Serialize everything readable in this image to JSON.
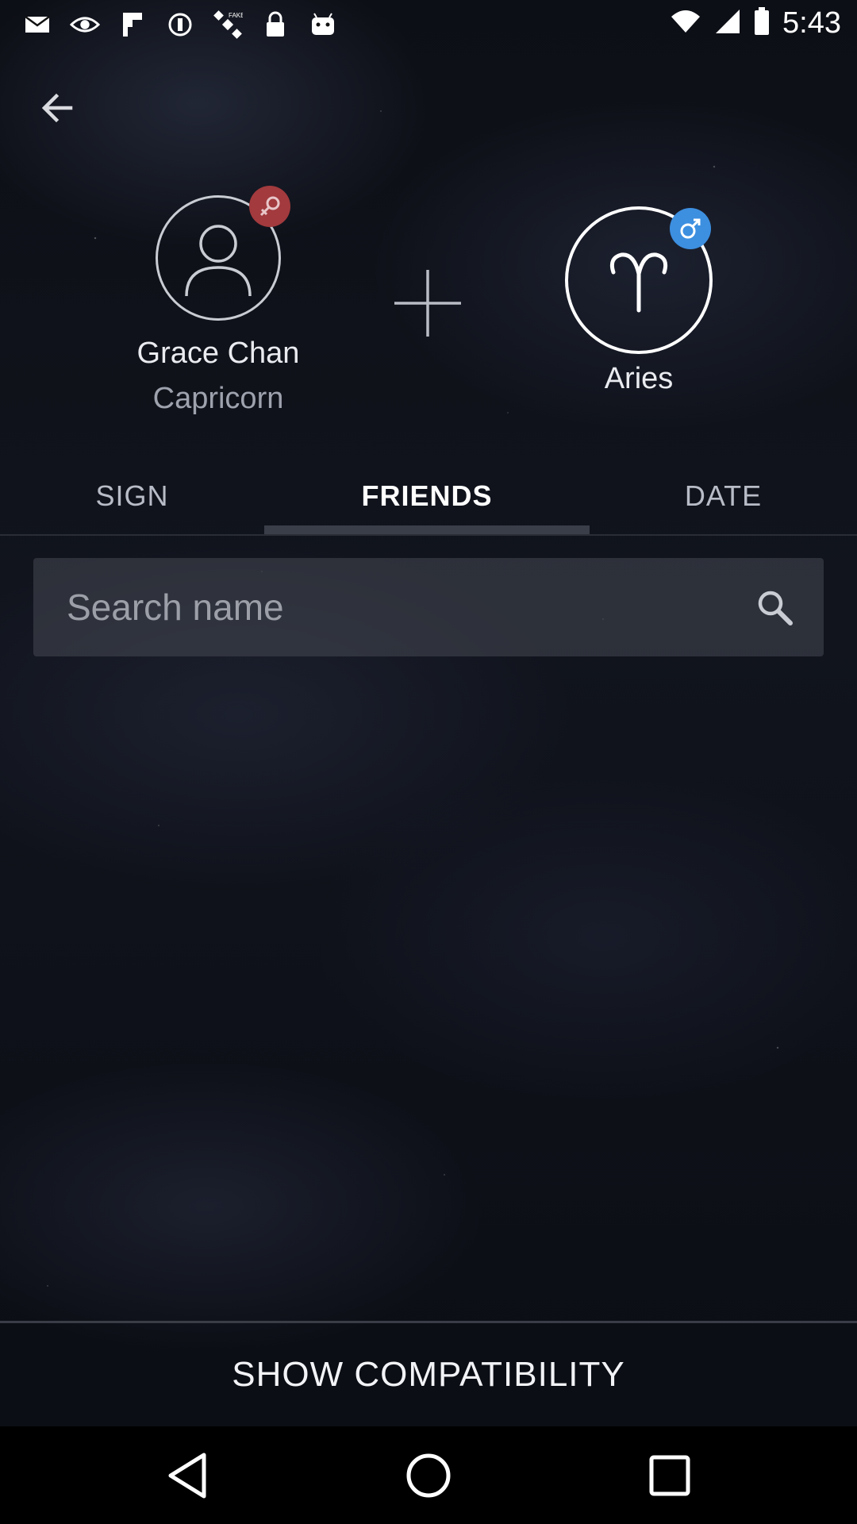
{
  "status_bar": {
    "time": "5:43",
    "icons": [
      "mail-icon",
      "eye-icon",
      "flipboard-icon",
      "info-icon",
      "satellite-icon",
      "lock-icon",
      "android-icon"
    ],
    "right_icons": [
      "wifi-icon",
      "signal-icon",
      "battery-icon"
    ]
  },
  "header": {
    "back_icon": "arrow-left-icon"
  },
  "person": {
    "name": "Grace Chan",
    "sign": "Capricorn",
    "gender_icon": "female-icon",
    "gender_color": "#a23a3e"
  },
  "plus_icon": "plus-icon",
  "partner": {
    "sign": "Aries",
    "sign_icon": "aries-icon",
    "gender_icon": "male-icon",
    "gender_color": "#3d8fe0"
  },
  "tabs": [
    {
      "label": "SIGN"
    },
    {
      "label": "FRIENDS"
    },
    {
      "label": "DATE"
    }
  ],
  "active_tab": "FRIENDS",
  "search": {
    "placeholder": "Search name",
    "value": ""
  },
  "compatibility_button": "SHOW COMPATIBILITY",
  "nav": [
    "back-nav-icon",
    "home-nav-icon",
    "recents-nav-icon"
  ]
}
